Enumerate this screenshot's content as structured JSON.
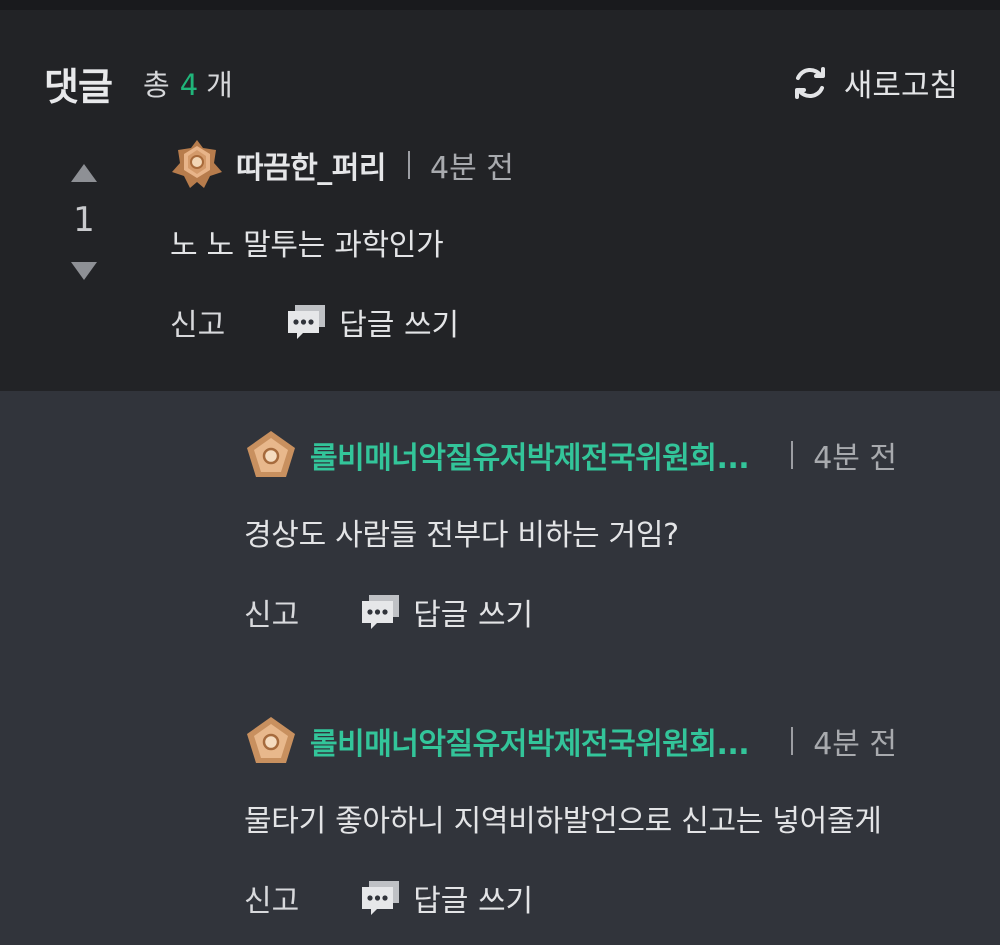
{
  "header": {
    "title": "댓글",
    "count_prefix": "총",
    "count": "4",
    "count_suffix": "개",
    "refresh_label": "새로고침"
  },
  "colors": {
    "accent_green": "#20b57a",
    "author_green": "#33c59a",
    "main_bg": "#222326",
    "reply_bg": "#31343b"
  },
  "comments": [
    {
      "author": "따끔한_퍼리",
      "time": "4분 전",
      "body": "노 노 말투는 과학인가",
      "score": "1",
      "report_label": "신고",
      "reply_label": "답글 쓰기",
      "badge_icon": "bronze-rank-badge-icon"
    },
    {
      "author": "롤비매너악질유저박제전국위원회...",
      "time": "4분 전",
      "body": "경상도 사람들 전부다 비하는 거임?",
      "report_label": "신고",
      "reply_label": "답글 쓰기",
      "badge_icon": "pentagon-rank-badge-icon"
    },
    {
      "author": "롤비매너악질유저박제전국위원회...",
      "time": "4분 전",
      "body": "물타기 좋아하니 지역비하발언으로 신고는 넣어줄게",
      "report_label": "신고",
      "reply_label": "답글 쓰기",
      "badge_icon": "pentagon-rank-badge-icon"
    }
  ]
}
